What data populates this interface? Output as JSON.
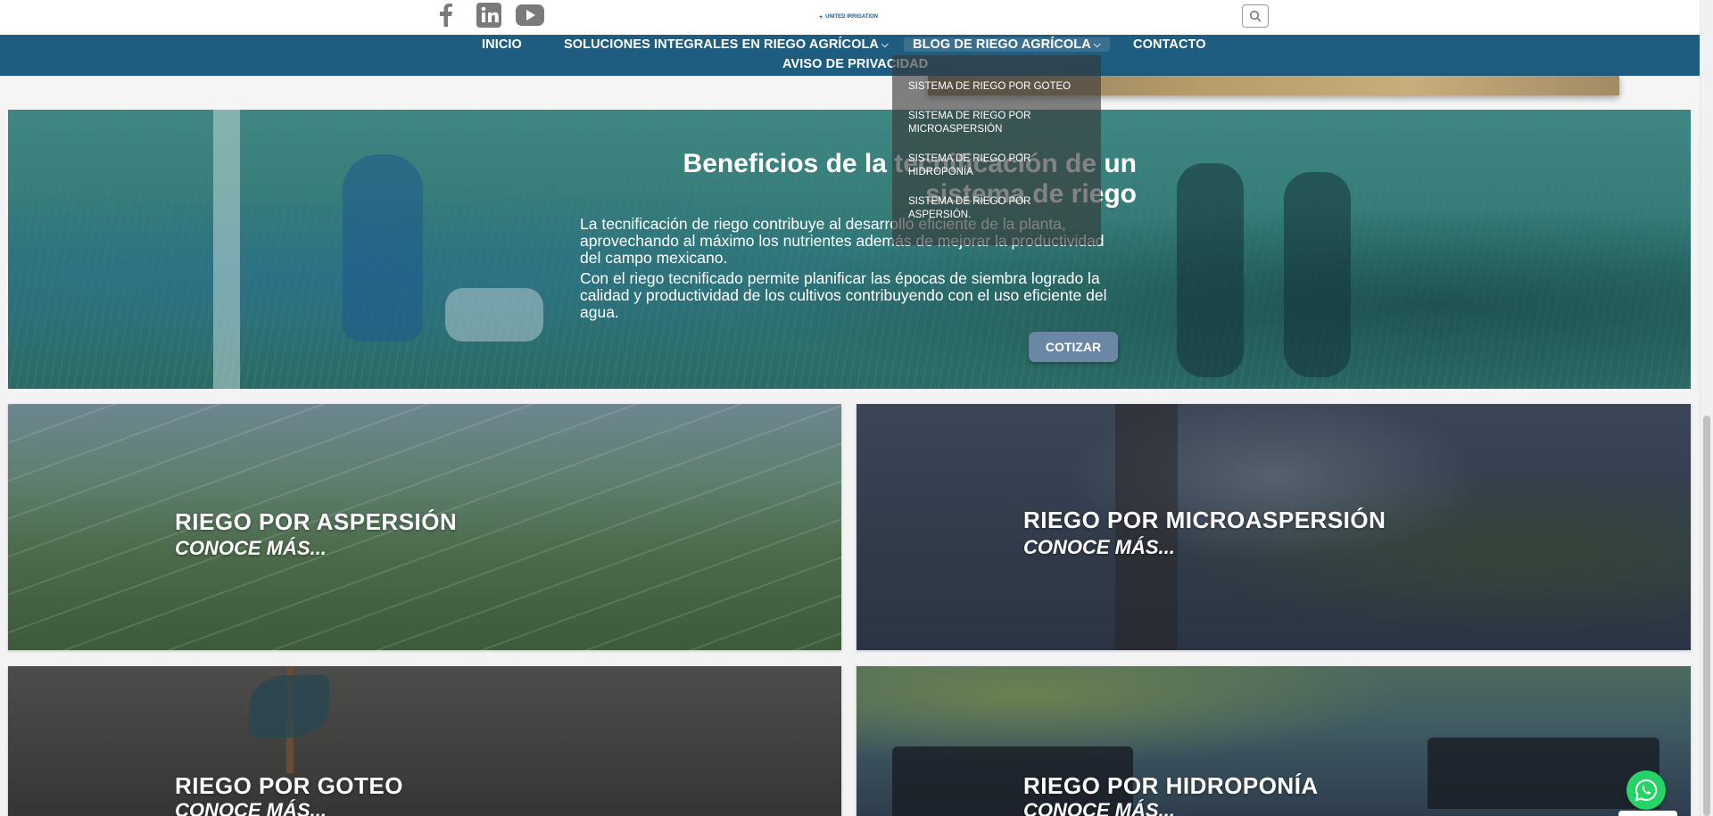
{
  "header": {
    "social": [
      {
        "name": "facebook",
        "icon": "facebook-icon"
      },
      {
        "name": "linkedin",
        "icon": "linkedin-icon"
      },
      {
        "name": "youtube",
        "icon": "youtube-icon"
      }
    ],
    "logo_text_line1": "UNITED IRRIGATION",
    "search_icon": "search-icon"
  },
  "nav": {
    "items": [
      {
        "label": "INICIO"
      },
      {
        "label": "SOLUCIONES INTEGRALES EN RIEGO AGRÍCOLA",
        "dropdown": true
      },
      {
        "label": "BLOG DE RIEGO AGRÍCOLA",
        "dropdown": true
      },
      {
        "label": "CONTACTO"
      },
      {
        "label": "AVISO DE PRIVACIDAD"
      }
    ],
    "chevron": "⌵"
  },
  "dropdown": {
    "items": [
      {
        "label": "SISTEMA DE RIEGO POR GOTEO"
      },
      {
        "label": "SISTEMA DE RIEGO POR MICROASPERSIÓN"
      },
      {
        "label": "SISTEMA DE RIEGO POR HIDROPONÍA"
      },
      {
        "label": "SISTEMA DE RIEGO POR ASPERSIÓN."
      }
    ]
  },
  "banner": {
    "title": "Beneficios de la tecnificación de un sistema de riego",
    "paragraph1": "La tecnificación de riego contribuye al desarrollo eficiente de la planta, aprovechando al máximo los nutrientes además de mejorar la productividad del campo mexicano.",
    "paragraph2": "Con el riego tecnificado permite planificar las épocas de siembra logrado la calidad y productividad de los cultivos contribuyendo con el uso eficiente del agua.",
    "button": "COTIZAR"
  },
  "cards": [
    {
      "title": "RIEGO POR ASPERSIÓN",
      "cta": "CONOCE MÁS..."
    },
    {
      "title": "RIEGO POR MICROASPERSIÓN",
      "cta": "CONOCE MÁS..."
    },
    {
      "title": "RIEGO POR GOTEO",
      "cta": "CONOCE MÁS..."
    },
    {
      "title": "RIEGO POR HIDROPONÍA",
      "cta": "CONOCE MÁS..."
    }
  ],
  "whatsapp": {
    "icon": "whatsapp-icon",
    "color": "#25d366"
  },
  "colors": {
    "nav": "#1f5d80",
    "button": "#6b87a6"
  }
}
